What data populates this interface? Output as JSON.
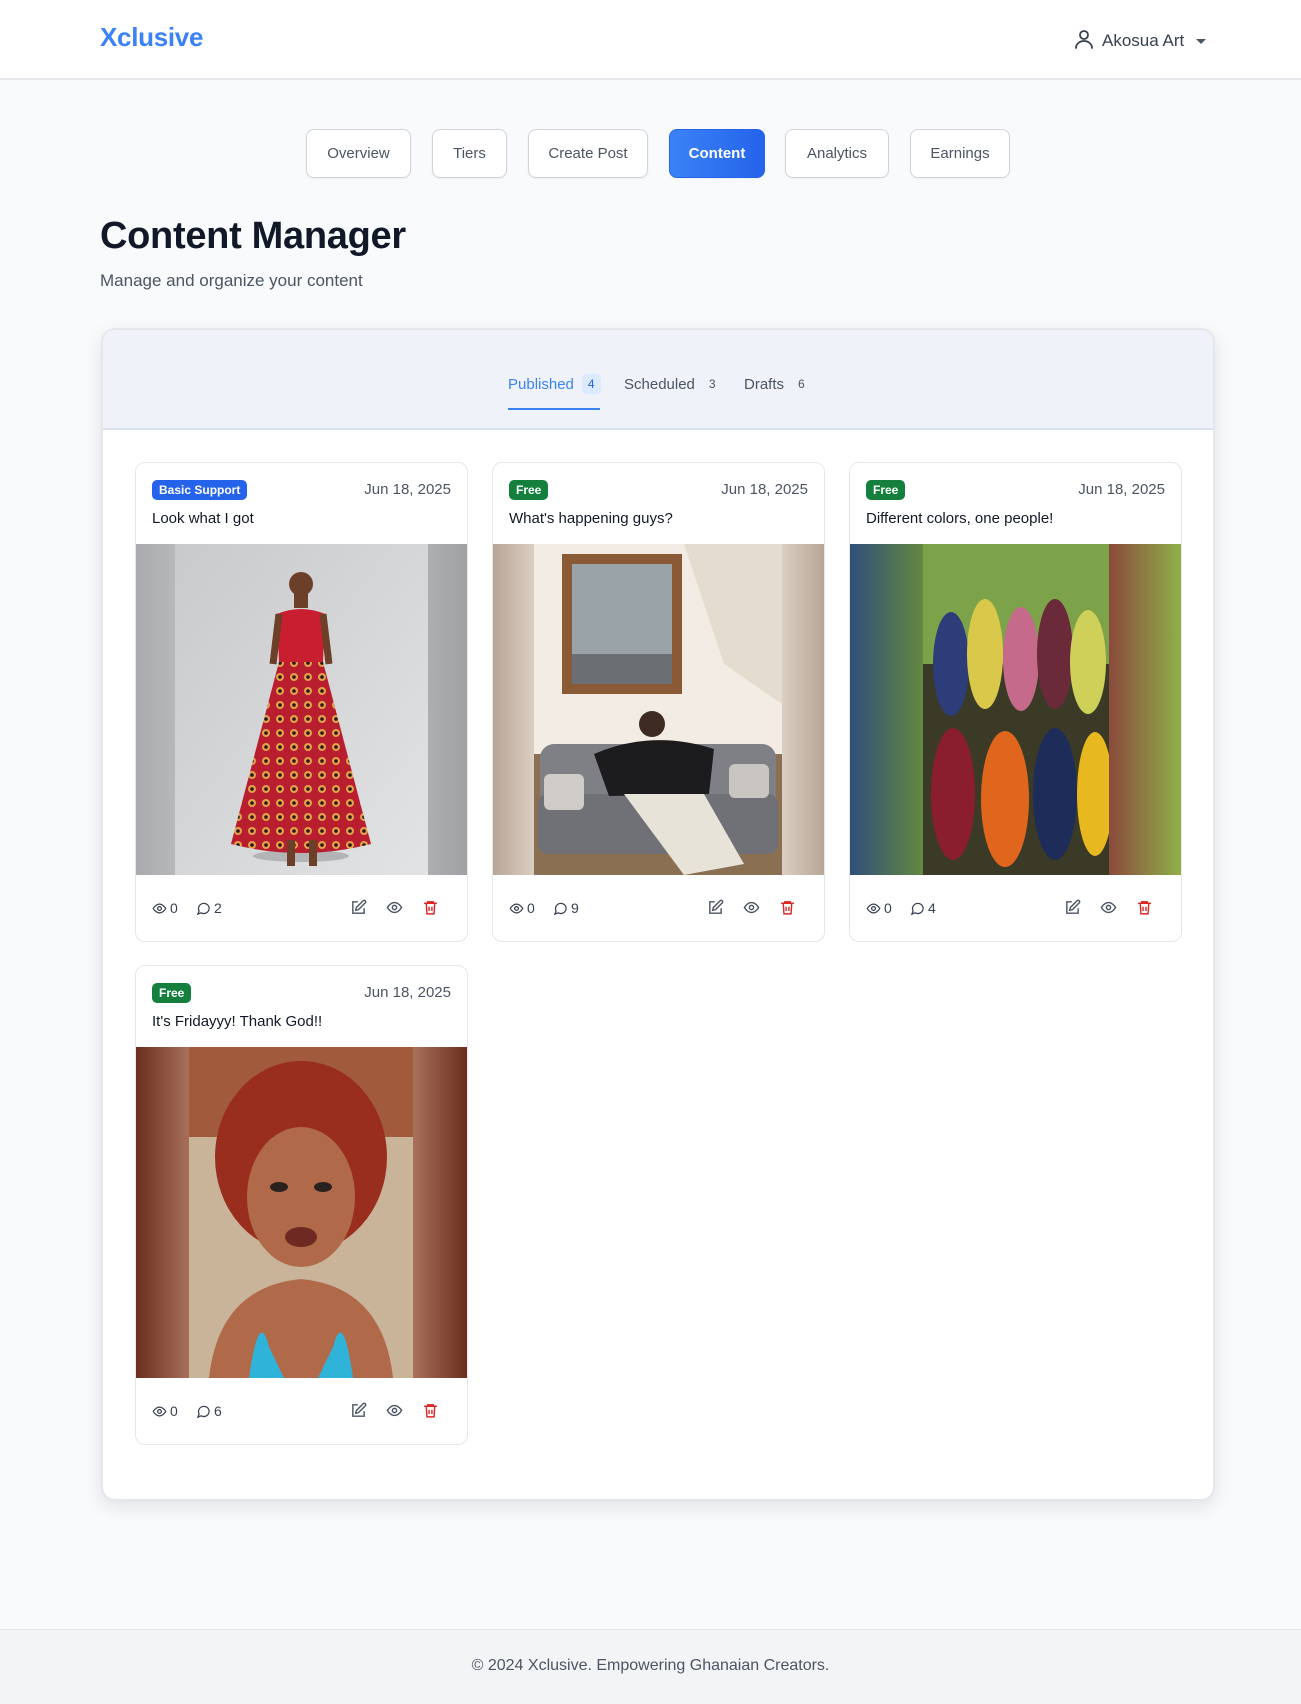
{
  "header": {
    "brand": "Xclusive",
    "user_name": "Akosua Art"
  },
  "nav": {
    "items": [
      {
        "label": "Overview",
        "active": false
      },
      {
        "label": "Tiers",
        "active": false
      },
      {
        "label": "Create Post",
        "active": false
      },
      {
        "label": "Content",
        "active": true
      },
      {
        "label": "Analytics",
        "active": false
      },
      {
        "label": "Earnings",
        "active": false
      }
    ]
  },
  "page": {
    "title": "Content Manager",
    "subtitle": "Manage and organize your content"
  },
  "content_tabs": [
    {
      "label": "Published",
      "count": "4",
      "active": true
    },
    {
      "label": "Scheduled",
      "count": "3",
      "active": false
    },
    {
      "label": "Drafts",
      "count": "6",
      "active": false
    }
  ],
  "posts": [
    {
      "tier": "Basic Support",
      "tier_color": "#2563eb",
      "date": "Jun 18, 2025",
      "caption": "Look what I got",
      "views": "0",
      "comments": "2",
      "image_subject": "woman in red patterned dress"
    },
    {
      "tier": "Free",
      "tier_color": "#15803d",
      "date": "Jun 18, 2025",
      "caption": "What's happening guys?",
      "views": "0",
      "comments": "9",
      "image_subject": "man relaxing on sofa"
    },
    {
      "tier": "Free",
      "tier_color": "#15803d",
      "date": "Jun 18, 2025",
      "caption": "Different colors, one people!",
      "views": "0",
      "comments": "4",
      "image_subject": "multicolored corn cobs"
    },
    {
      "tier": "Free",
      "tier_color": "#15803d",
      "date": "Jun 18, 2025",
      "caption": "It's Fridayyy! Thank God!!",
      "views": "0",
      "comments": "6",
      "image_subject": "woman with curly red hair"
    }
  ],
  "footer": {
    "text": "© 2024 Xclusive. Empowering Ghanaian Creators."
  },
  "colors": {
    "accent": "#3b82f6",
    "tier_basic": "#2563eb",
    "tier_free": "#15803d",
    "delete": "#dc2626"
  }
}
